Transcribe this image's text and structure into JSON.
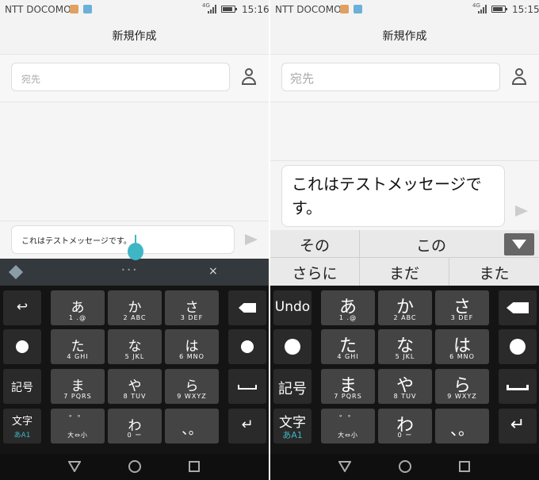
{
  "left": {
    "status": {
      "carrier": "NTT DOCOMO",
      "network": "4G",
      "time": "15:16"
    },
    "title": "新規作成",
    "to_placeholder": "宛先",
    "message": "これはテストメッセージです。",
    "keys": {
      "row1": [
        {
          "kana": "あ",
          "sub": "1 .@"
        },
        {
          "kana": "か",
          "sub": "2 ABC"
        },
        {
          "kana": "さ",
          "sub": "3 DEF"
        }
      ],
      "row2": [
        {
          "kana": "た",
          "sub": "4 GHI"
        },
        {
          "kana": "な",
          "sub": "5 JKL"
        },
        {
          "kana": "は",
          "sub": "6 MNO"
        }
      ],
      "row3": [
        {
          "kana": "ま",
          "sub": "7 PQRS"
        },
        {
          "kana": "や",
          "sub": "8 TUV"
        },
        {
          "kana": "ら",
          "sub": "9 WXYZ"
        }
      ],
      "row4": [
        {
          "kana": "゛゜",
          "sub": "大⇔小"
        },
        {
          "kana": "わ",
          "sub": "0 ー"
        },
        {
          "kana": "、。",
          "sub": ""
        }
      ],
      "kigo": "記号",
      "moji": "文字",
      "moji_sub": "あA1",
      "close": "×",
      "dots": "• • •"
    }
  },
  "right": {
    "status": {
      "carrier": "NTT DOCOMO",
      "network": "4G",
      "time": "15:15"
    },
    "title": "新規作成",
    "to_placeholder": "宛先",
    "message": "これはテストメッセージです。",
    "candidates_row1": [
      "その",
      "この"
    ],
    "candidates_row2": [
      "さらに",
      "まだ",
      "また"
    ],
    "keys": {
      "undo": "Undo",
      "row1": [
        {
          "kana": "あ",
          "sub": "1 .@"
        },
        {
          "kana": "か",
          "sub": "2 ABC"
        },
        {
          "kana": "さ",
          "sub": "3 DEF"
        }
      ],
      "row2": [
        {
          "kana": "た",
          "sub": "4 GHI"
        },
        {
          "kana": "な",
          "sub": "5 JKL"
        },
        {
          "kana": "は",
          "sub": "6 MNO"
        }
      ],
      "row3": [
        {
          "kana": "ま",
          "sub": "7 PQRS"
        },
        {
          "kana": "や",
          "sub": "8 TUV"
        },
        {
          "kana": "ら",
          "sub": "9 WXYZ"
        }
      ],
      "row4": [
        {
          "kana": "゛゜",
          "sub": "大⇔小"
        },
        {
          "kana": "わ",
          "sub": "0 ー"
        },
        {
          "kana": "、。",
          "sub": ""
        }
      ],
      "kigo": "記号",
      "moji": "文字",
      "moji_sub": "あA1"
    }
  },
  "colors": {
    "accent": "#3fb6c6",
    "key": "#444444",
    "keyboard_bg": "#141414"
  }
}
